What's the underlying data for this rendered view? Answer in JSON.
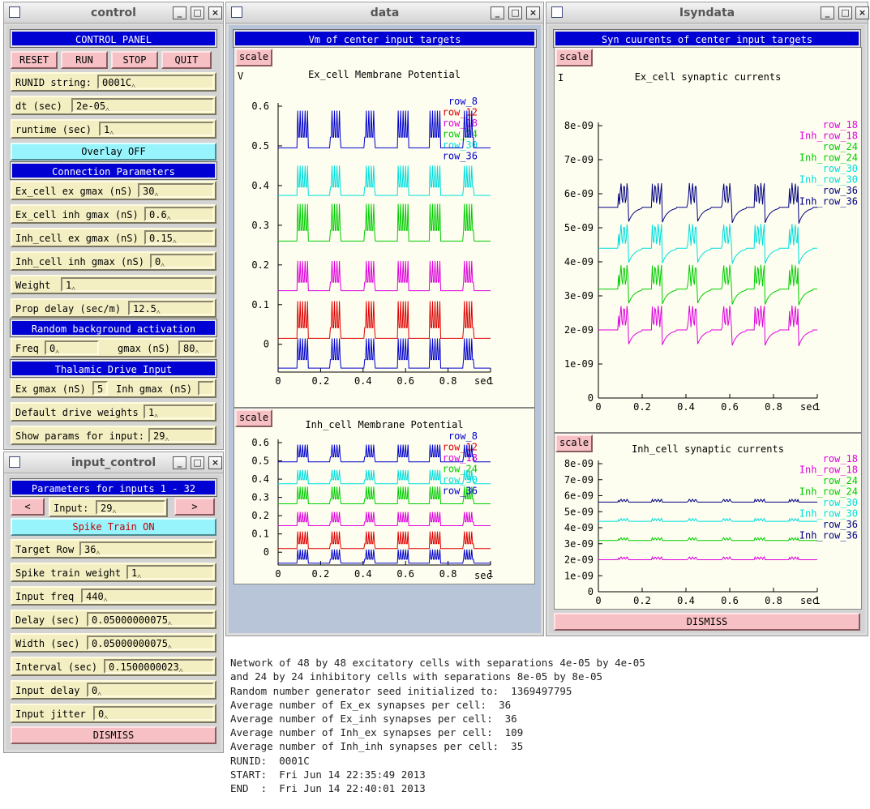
{
  "control": {
    "title": "control",
    "panel_title": "CONTROL PANEL",
    "buttons": [
      "RESET",
      "RUN",
      "STOP",
      "QUIT"
    ],
    "runid_label": "RUNID string:",
    "runid": "0001C",
    "dt_label": "dt (sec)",
    "dt": "2e-05",
    "runtime_label": "runtime (sec)",
    "runtime": "1",
    "overlay": "Overlay OFF",
    "conn_title": "Connection Parameters",
    "conn": [
      {
        "label": "Ex_cell ex gmax (nS)",
        "value": "30"
      },
      {
        "label": "Ex_cell inh gmax (nS)",
        "value": "0.6"
      },
      {
        "label": "Inh_cell ex gmax (nS)",
        "value": "0.15"
      },
      {
        "label": "Inh_cell inh gmax (nS)",
        "value": "0"
      }
    ],
    "weight_label": "Weight",
    "weight": "1",
    "prop_label": "Prop delay (sec/m)",
    "prop": "12.5",
    "rand_title": "Random background activation",
    "freq_label": "Freq",
    "freq": "0",
    "gmax_label": "gmax (nS)",
    "gmax": "80",
    "thal_title": "Thalamic Drive Input",
    "exg_label": "Ex gmax (nS)",
    "exg": "5",
    "inhg_label": "Inh gmax (nS)",
    "inhg": "",
    "drive_label": "Default drive weights",
    "drive": "1",
    "show_label": "Show params for input:",
    "show": "29"
  },
  "input_control": {
    "title": "input_control",
    "header": "Parameters for inputs 1 - 32",
    "prev": "<",
    "next": ">",
    "input_label": "Input:",
    "input": "29",
    "spike": "Spike Train ON",
    "rows": [
      {
        "label": "Target Row",
        "value": "36"
      },
      {
        "label": "Spike train weight",
        "value": "1"
      },
      {
        "label": "Input freq",
        "value": "440"
      },
      {
        "label": "Delay (sec)",
        "value": "0.05000000075"
      },
      {
        "label": "Width (sec)",
        "value": "0.05000000075"
      },
      {
        "label": "Interval (sec)",
        "value": "0.1500000023"
      },
      {
        "label": "Input delay",
        "value": "0"
      },
      {
        "label": "Input jitter",
        "value": "0"
      }
    ],
    "dismiss": "DISMISS"
  },
  "data": {
    "title": "data",
    "header": "Vm of center input targets",
    "scale": "scale",
    "top": {
      "title": "Ex_cell Membrane Potential",
      "yunit": "V",
      "xunit": "sec"
    },
    "bottom": {
      "title": "Inh_cell Membrane Potential",
      "xunit": "sec"
    }
  },
  "isyn": {
    "title": "Isyndata",
    "header": "Syn cuurents of center input targets",
    "scale": "scale",
    "top": {
      "title": "Ex_cell synaptic currents",
      "yunit": "I",
      "xunit": "sec"
    },
    "bottom": {
      "title": "Inh_cell synaptic currents",
      "xunit": "sec"
    },
    "dismiss": "DISMISS"
  },
  "colors": {
    "blue": "#0000cc",
    "red": "#dd0000",
    "magenta": "#dd00dd",
    "green": "#00cc00",
    "cyan": "#00dddd",
    "navy": "#000080"
  },
  "chart_data": [
    {
      "type": "line",
      "title": "Ex_cell Membrane Potential",
      "ylabel": "V",
      "xlabel": "sec",
      "xlim": [
        0,
        1
      ],
      "ylim": [
        -0.07,
        0.6
      ],
      "xticks": [
        0,
        0.2,
        0.4,
        0.6,
        0.8,
        1
      ],
      "yticks": [
        0,
        0.1,
        0.2,
        0.3,
        0.4,
        0.5,
        0.6
      ],
      "series": [
        {
          "name": "row_8",
          "color": "#0000cc",
          "base": -0.06
        },
        {
          "name": "row_12",
          "color": "#dd0000",
          "base": 0.015
        },
        {
          "name": "row_18",
          "color": "#dd00dd",
          "base": 0.135
        },
        {
          "name": "row_24",
          "color": "#00cc00",
          "base": 0.26
        },
        {
          "name": "row_30",
          "color": "#00dddd",
          "base": 0.375
        },
        {
          "name": "row_36",
          "color": "#0000cc",
          "base": 0.495
        }
      ]
    },
    {
      "type": "line",
      "title": "Inh_cell Membrane Potential",
      "xlabel": "sec",
      "xlim": [
        0,
        1
      ],
      "ylim": [
        -0.07,
        0.6
      ],
      "xticks": [
        0,
        0.2,
        0.4,
        0.6,
        0.8,
        1
      ],
      "yticks": [
        0,
        0.1,
        0.2,
        0.3,
        0.4,
        0.5,
        0.6
      ],
      "series": [
        {
          "name": "row_8",
          "color": "#0000cc",
          "base": -0.06
        },
        {
          "name": "row_12",
          "color": "#dd0000",
          "base": 0.02
        },
        {
          "name": "row_18",
          "color": "#dd00dd",
          "base": 0.145
        },
        {
          "name": "row_24",
          "color": "#00cc00",
          "base": 0.265
        },
        {
          "name": "row_30",
          "color": "#00dddd",
          "base": 0.375
        },
        {
          "name": "row_36",
          "color": "#0000cc",
          "base": 0.495
        }
      ]
    },
    {
      "type": "line",
      "title": "Ex_cell synaptic currents",
      "ylabel": "I",
      "xlabel": "sec",
      "xlim": [
        0,
        1
      ],
      "ylim": [
        0,
        8e-09
      ],
      "xticks": [
        0,
        0.2,
        0.4,
        0.6,
        0.8,
        1
      ],
      "yticks": [
        "0",
        "1e-09",
        "2e-09",
        "3e-09",
        "4e-09",
        "5e-09",
        "6e-09",
        "7e-09",
        "8e-09"
      ],
      "series": [
        {
          "name": "row_18",
          "color": "#dd00dd",
          "base": 2e-09
        },
        {
          "name": "Inh_row_18",
          "color": "#dd00dd",
          "base": 2e-09
        },
        {
          "name": "row_24",
          "color": "#00cc00",
          "base": 3.2e-09
        },
        {
          "name": "Inh_row_24",
          "color": "#00cc00",
          "base": 3.2e-09
        },
        {
          "name": "row_30",
          "color": "#00dddd",
          "base": 4.4e-09
        },
        {
          "name": "Inh_row_30",
          "color": "#00dddd",
          "base": 4.4e-09
        },
        {
          "name": "row_36",
          "color": "#000080",
          "base": 5.6e-09
        },
        {
          "name": "Inh_row_36",
          "color": "#000080",
          "base": 5.6e-09
        }
      ]
    },
    {
      "type": "line",
      "title": "Inh_cell synaptic currents",
      "xlabel": "sec",
      "xlim": [
        0,
        1
      ],
      "ylim": [
        0,
        8e-09
      ],
      "xticks": [
        0,
        0.2,
        0.4,
        0.6,
        0.8,
        1
      ],
      "yticks": [
        "0",
        "1e-09",
        "2e-09",
        "3e-09",
        "4e-09",
        "5e-09",
        "6e-09",
        "7e-09",
        "8e-09"
      ],
      "series": [
        {
          "name": "row_18",
          "color": "#dd00dd",
          "base": 2e-09
        },
        {
          "name": "Inh_row_18",
          "color": "#dd00dd",
          "base": 2e-09
        },
        {
          "name": "row_24",
          "color": "#00cc00",
          "base": 3.2e-09
        },
        {
          "name": "Inh_row_24",
          "color": "#00cc00",
          "base": 3.2e-09
        },
        {
          "name": "row_30",
          "color": "#00dddd",
          "base": 4.4e-09
        },
        {
          "name": "Inh_row_30",
          "color": "#00dddd",
          "base": 4.4e-09
        },
        {
          "name": "row_36",
          "color": "#000080",
          "base": 5.6e-09
        },
        {
          "name": "Inh_row_36",
          "color": "#000080",
          "base": 5.6e-09
        }
      ]
    }
  ],
  "terminal": [
    "Network of 48 by 48 excitatory cells with separations 4e-05 by 4e-05",
    "and 24 by 24 inhibitory cells with separations 8e-05 by 8e-05",
    "Random number generator seed initialized to:  1369497795",
    "Average number of Ex_ex synapses per cell:  36",
    "Average number of Ex_inh synapses per cell:  36",
    "Average number of Inh_ex synapses per cell:  109",
    "Average number of Inh_inh synapses per cell:  35",
    "RUNID:  0001C",
    "START:  Fri Jun 14 22:35:49 2013",
    "END  :  Fri Jun 14 22:40:01 2013"
  ]
}
